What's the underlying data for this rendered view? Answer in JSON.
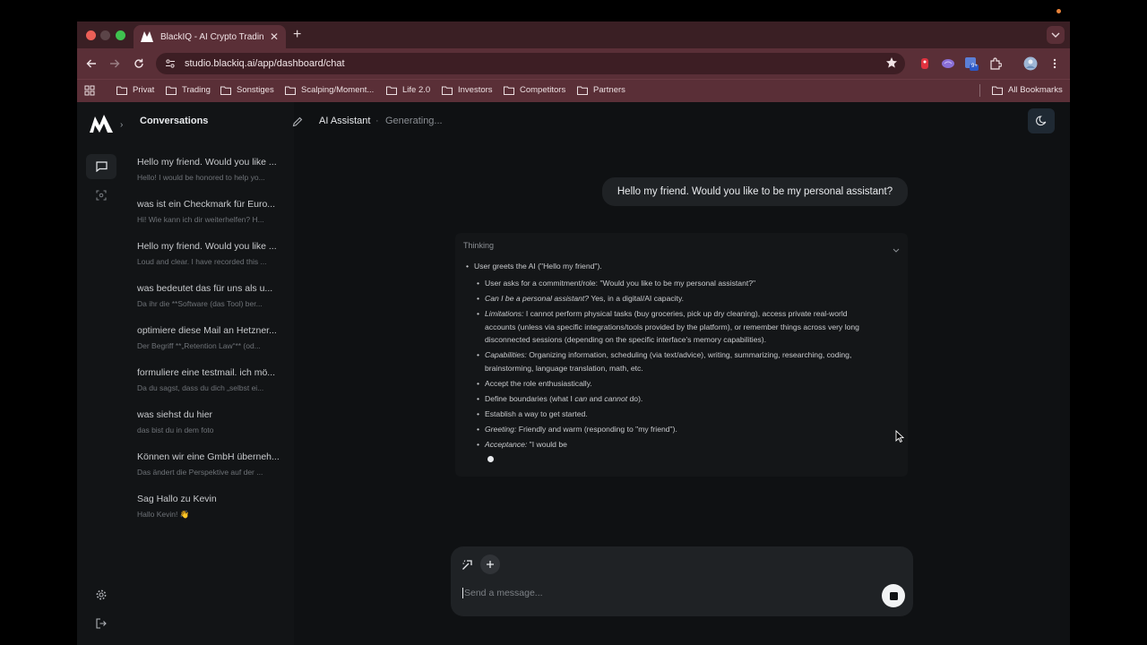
{
  "browser": {
    "tab_title": "BlackIQ - AI Crypto Trading P",
    "url": "studio.blackiq.ai/app/dashboard/chat",
    "bookmarks": [
      {
        "label": "Privat"
      },
      {
        "label": "Trading"
      },
      {
        "label": "Sonstiges"
      },
      {
        "label": "Scalping/Moment..."
      },
      {
        "label": "Life 2.0"
      },
      {
        "label": "Investors"
      },
      {
        "label": "Competitors"
      },
      {
        "label": "Partners"
      }
    ],
    "all_bookmarks": "All Bookmarks",
    "extension_badge": "9+"
  },
  "sidebar": {
    "title": "Conversations",
    "conversations": [
      {
        "title": "Hello my friend. Would you like ...",
        "preview": "Hello! I would be honored to help yo..."
      },
      {
        "title": "was ist ein Checkmark für Euro...",
        "preview": "Hi! Wie kann ich dir weiterhelfen? H..."
      },
      {
        "title": "Hello my friend. Would you like ...",
        "preview": "Loud and clear. I have recorded this ..."
      },
      {
        "title": "was bedeutet das für uns als u...",
        "preview": "Da ihr die **Software (das Tool) ber..."
      },
      {
        "title": "optimiere diese Mail an Hetzner...",
        "preview": "Der Begriff **„Retention Law“** (od..."
      },
      {
        "title": "formuliere eine testmail. ich mö...",
        "preview": "Da du sagst, dass du dich „selbst ei..."
      },
      {
        "title": "was siehst du hier",
        "preview": "das bist du in dem foto"
      },
      {
        "title": "Können wir eine GmbH überneh...",
        "preview": "Das ändert die Perspektive auf der ..."
      },
      {
        "title": "Sag Hallo zu Kevin",
        "preview": "Hallo Kevin! 👋"
      }
    ]
  },
  "header": {
    "title": "AI Assistant",
    "separator": "·",
    "status": "Generating..."
  },
  "chat": {
    "user_message": "Hello my friend. Would you like to be my personal assistant?",
    "thinking": {
      "label": "Thinking",
      "l1": "User greets the AI (\"Hello my friend\").",
      "l2": "User asks for a commitment/role: \"Would you like to be my personal assistant?\"",
      "l3_em": "Can I be a personal assistant?",
      "l3_rest": " Yes, in a digital/AI capacity.",
      "l4_em": "Limitations:",
      "l4_a": " I cannot perform physical tasks (buy groceries, pick up dry cleaning), access private real-world",
      "l4_b": "accounts (unless via specific integrations/tools provided by the platform), or remember things across very long",
      "l4_c": "disconnected sessions (depending on the specific interface's memory capabilities).",
      "l5_em": "Capabilities:",
      "l5_a": " Organizing information, scheduling (via text/advice), writing, summarizing, researching, coding,",
      "l5_b": "brainstorming, language translation, math, etc.",
      "l6": "Accept the role enthusiastically.",
      "l7_a": "Define boundaries (what I ",
      "l7_em1": "can",
      "l7_b": " and ",
      "l7_em2": "cannot",
      "l7_c": " do).",
      "l8": "Establish a way to get started.",
      "l9_em": "Greeting:",
      "l9_rest": " Friendly and warm (responding to \"my friend\").",
      "l10_em": "Acceptance:",
      "l10_rest": " \"I would be"
    }
  },
  "composer": {
    "placeholder": "Send a message..."
  }
}
